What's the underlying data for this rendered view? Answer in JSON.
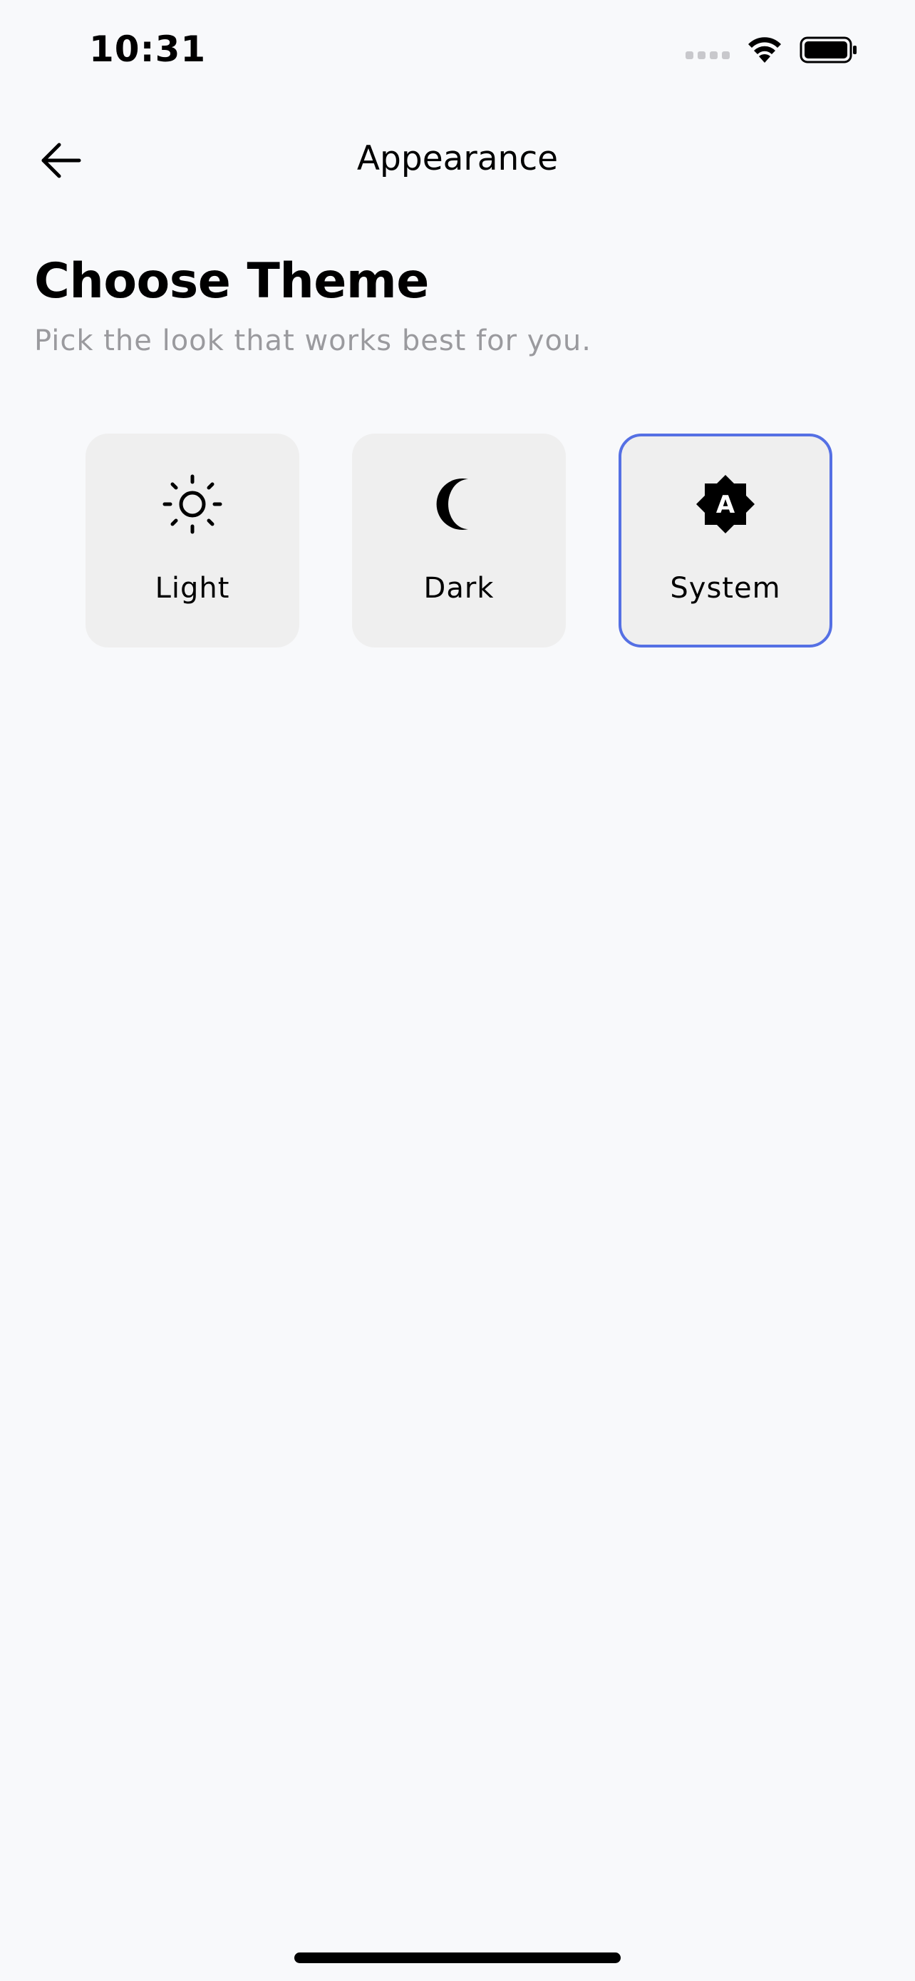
{
  "status_bar": {
    "time": "10:31",
    "icons": [
      "cellular-signal-icon",
      "wifi-icon",
      "battery-icon"
    ]
  },
  "nav": {
    "back_icon": "arrow-left-icon",
    "title": "Appearance"
  },
  "content": {
    "heading": "Choose Theme",
    "subtitle": "Pick the look that works best for you."
  },
  "themes": [
    {
      "label": "Light",
      "icon": "sun-icon",
      "selected": false
    },
    {
      "label": "Dark",
      "icon": "moon-icon",
      "selected": false
    },
    {
      "label": "System",
      "icon": "brightness-auto-icon",
      "icon_letter": "A",
      "selected": true
    }
  ],
  "colors": {
    "background": "#f8f9fb",
    "card": "#efefef",
    "selected_border": "#5570e4",
    "subtitle": "#9a9a9e"
  }
}
